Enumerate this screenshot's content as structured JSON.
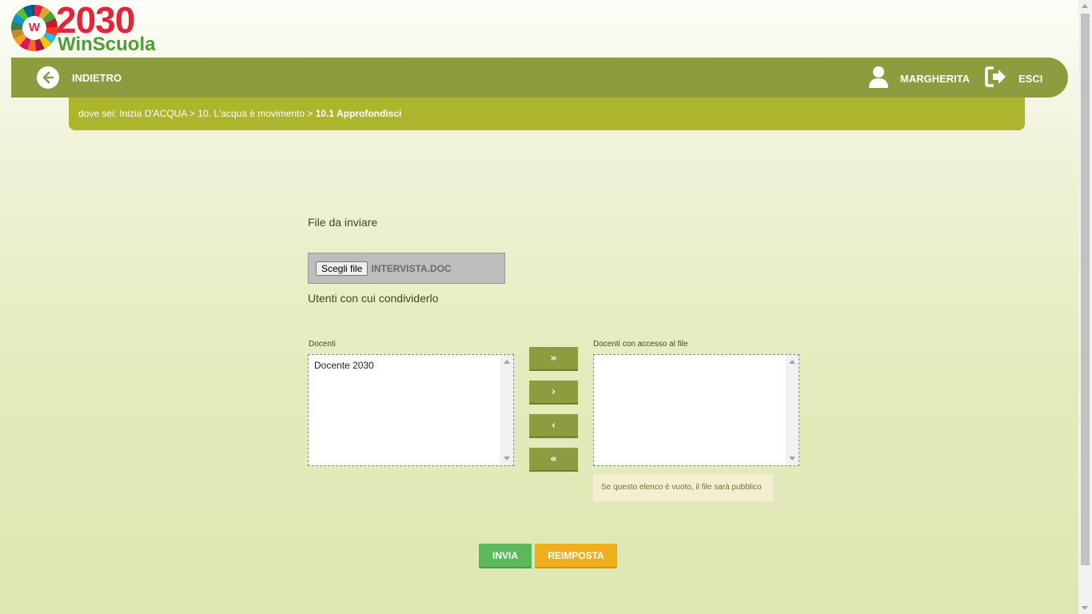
{
  "logo": {
    "number": "2030",
    "name": "WinScuola",
    "badge": "W"
  },
  "topbar": {
    "back_label": "INDIETRO",
    "user_label": "MARGHERITA",
    "logout_label": "ESCI"
  },
  "breadcrumb": {
    "prefix": "dove sei: Inizia D'ACQUA > 10. L'acqua è movimento > ",
    "current": "10.1 Approfondisci"
  },
  "form": {
    "file_label": "File da inviare",
    "file_button": "Scegli file",
    "file_name": "INTERVISTA.DOC",
    "share_label": "Utenti con cui condividerlo",
    "left_list": {
      "label": "Docenti",
      "options": [
        "Docente 2030"
      ]
    },
    "right_list": {
      "label": "Docenti con accesso al file",
      "options": []
    },
    "move_buttons": {
      "all_right": "»",
      "right": "›",
      "left": "‹",
      "all_left": "«"
    },
    "empty_note": "Se questo elenco è vuoto, il file sarà pubblico",
    "submit_label": "INVIA",
    "reset_label": "REIMPOSTA"
  },
  "colors": {
    "topbar": "#8b9d3f",
    "breadcrumb": "#acb52b",
    "submit": "#5cb85c",
    "reset": "#f0ad1c"
  },
  "icons": {
    "back": "arrow-left-circle-icon",
    "user": "user-icon",
    "logout": "sign-out-icon"
  }
}
